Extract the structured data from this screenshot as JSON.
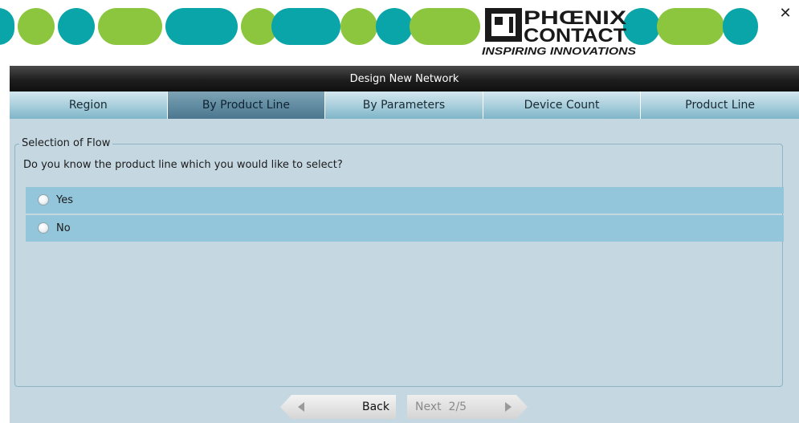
{
  "header": {
    "brand_name": "PHOENIX CONTACT",
    "brand_line1": "PHŒNIX",
    "brand_line2": "CONTACT",
    "tagline": "INSPIRING INNOVATIONS",
    "close_icon": "close-icon",
    "colors": {
      "teal": "#0aa5a8",
      "green": "#8cc63f"
    }
  },
  "window": {
    "title": "Design New Network"
  },
  "tabs": [
    {
      "label": "Region",
      "active": false
    },
    {
      "label": "By Product Line",
      "active": true
    },
    {
      "label": "By Parameters",
      "active": false
    },
    {
      "label": "Device Count",
      "active": false
    },
    {
      "label": "Product Line",
      "active": false
    }
  ],
  "flow": {
    "legend": "Selection of Flow",
    "question": "Do you know the product line which you would like to select?",
    "options": [
      {
        "label": "Yes",
        "selected": false
      },
      {
        "label": "No",
        "selected": false
      }
    ]
  },
  "nav": {
    "back_label": "Back",
    "next_label": "Next",
    "page": "2/5"
  }
}
